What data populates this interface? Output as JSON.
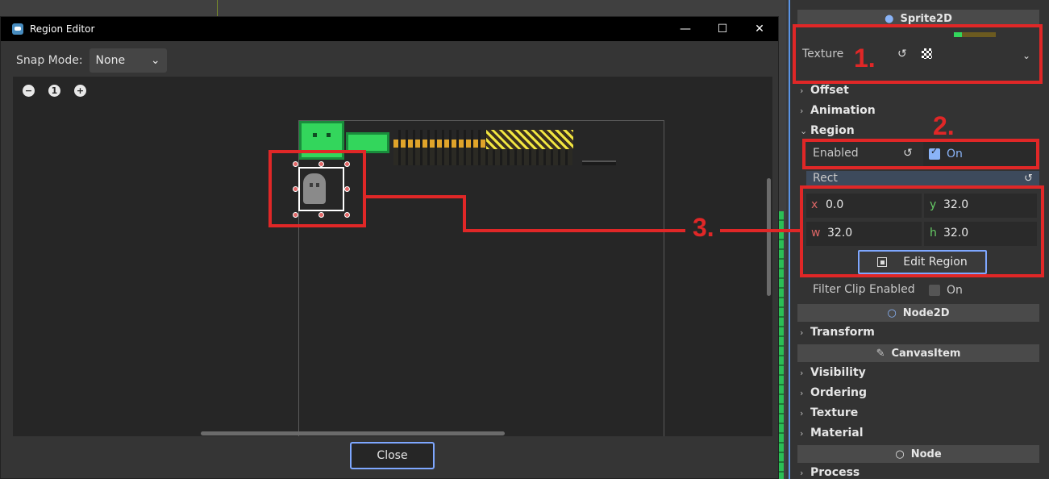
{
  "dialog": {
    "title": "Region Editor",
    "window_buttons": [
      "—",
      "☐",
      "✕"
    ],
    "snap_label": "Snap Mode:",
    "snap_value": "None",
    "zoom": {
      "out": "−",
      "reset": "1",
      "in": "+"
    },
    "close_label": "Close"
  },
  "inspector": {
    "header_sprite": "Sprite2D",
    "texture_label": "Texture",
    "groups": [
      "Offset",
      "Animation",
      "Region"
    ],
    "region": {
      "enabled_label": "Enabled",
      "enabled_value": "On",
      "rect_label": "Rect",
      "x_letter": "x",
      "x_value": "0.0",
      "y_letter": "y",
      "y_value": "32.0",
      "w_letter": "w",
      "w_value": "32.0",
      "h_letter": "h",
      "h_value": "32.0",
      "edit_region_label": "Edit Region",
      "filter_clip_label": "Filter Clip Enabled",
      "filter_clip_value": "On"
    },
    "header_node2d": "Node2D",
    "transform_label": "Transform",
    "header_canvasitem": "CanvasItem",
    "canvasitem_groups": [
      "Visibility",
      "Ordering",
      "Texture",
      "Material"
    ],
    "header_node": "Node",
    "process_label": "Process"
  },
  "annotations": {
    "a1": "1.",
    "a2": "2.",
    "a3": "3."
  },
  "colors": {
    "annotation": "#e02727",
    "accent": "#8ab4f8",
    "green_sprite": "#33d65c"
  }
}
